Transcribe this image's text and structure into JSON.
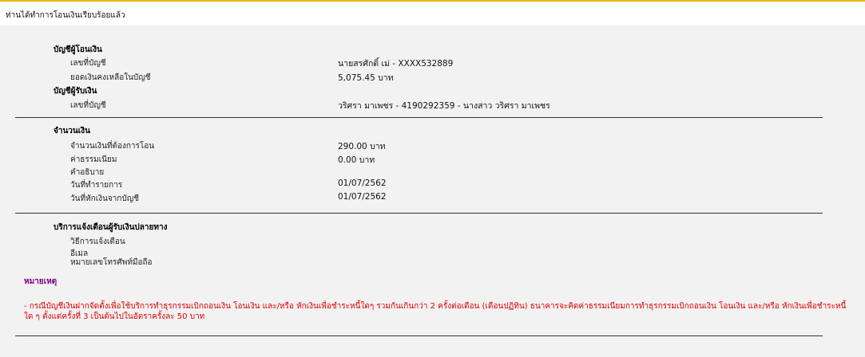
{
  "header": {
    "title": "ท่านได้ทำการโอนเงินเรียบร้อยแล้ว"
  },
  "from_account": {
    "heading": "บัญชีผู้โอนเงิน",
    "account_label": "เลขที่บัญชี",
    "account_value": "นายสรศักดิ์ เม่ - XXXX532889",
    "balance_label": "ยอดเงินคงเหลือในบัญชี",
    "balance_value": "5,075.45 บาท"
  },
  "to_account": {
    "heading": "บัญชีผู้รับเงิน",
    "account_label": "เลขที่บัญชี",
    "account_value": "วริศรา มาเพชร - 4190292359 - นางสาว วริศรา มาเพชร"
  },
  "amount": {
    "heading": "จำนวนเงิน",
    "transfer_label": "จำนวนเงินที่ต้องการโอน",
    "transfer_value": "290.00 บาท",
    "fee_label": "ค่าธรรมเนียม",
    "fee_value": "0.00  บาท",
    "description_label": "คำอธิบาย",
    "transaction_date_label": "วันที่ทำรายการ",
    "transaction_date_value": "01/07/2562",
    "debit_date_label": "วันที่หักเงินจากบัญชี",
    "debit_date_value": "01/07/2562"
  },
  "notify": {
    "heading": "บริการแจ้งเตือนผู้รับเงินปลายทาง",
    "method_label": "วิธีการแจ้งเตือน",
    "email_label": "อีเมล",
    "phone_label": "หมายเลขโทรศัพท์มือถือ"
  },
  "remark": {
    "heading": "หมายเหตุ",
    "text": "- กรณีบัญชีเงินฝากจัดตั้งเพื่อใช้บริการทำธุรกรรมเบิกถอนเงิน โอนเงิน และ/หรือ หักเงินเพื่อชำระหนี้ใดๆ รวมกันเกินกว่า 2 ครั้งต่อเดือน (เดือนปฏิทิน) ธนาคารจะคิดค่าธรรมเนียมการทำธุรกรรมเบิกถอนเงิน โอนเงิน และ/หรือ หักเงินเพื่อชำระหนี้ใด ๆ ตั้งแต่ครั้งที่ 3 เป็นต้นไปในอัตราครั้งละ 50 บาท"
  },
  "colors": {
    "accent": "#f0b400",
    "remark_heading": "#7a0080",
    "remark_text": "#e00000"
  }
}
